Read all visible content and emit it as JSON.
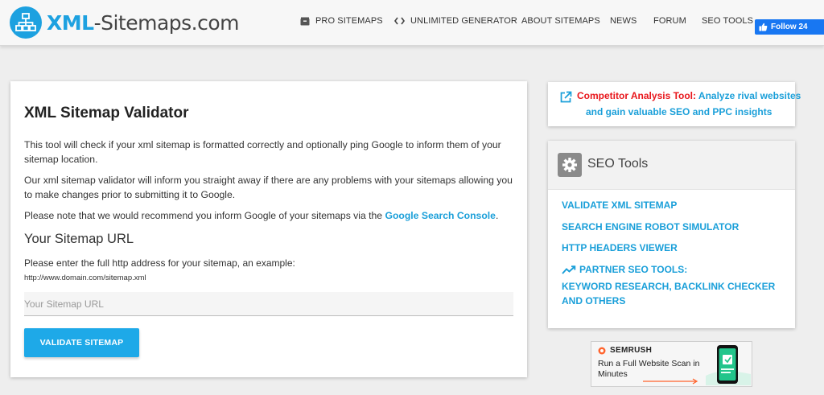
{
  "header": {
    "logo_xml": "XML",
    "logo_rest": "-Sitemaps.com",
    "nav": [
      {
        "label": "PRO SITEMAPS",
        "icon": "box-icon"
      },
      {
        "label": "UNLIMITED GENERATOR",
        "icon": "code-icon"
      },
      {
        "label": "ABOUT SITEMAPS"
      },
      {
        "label": "NEWS"
      },
      {
        "label": "FORUM"
      },
      {
        "label": "SEO TOOLS"
      }
    ],
    "follow_label": "Follow 24"
  },
  "main": {
    "title": "XML Sitemap Validator",
    "para1": "This tool will check if your xml sitemap is formatted correctly and optionally ping Google to inform them of your sitemap location.",
    "para2": "Our xml sitemap validator will inform you straight away if there are any problems with your sitemaps allowing you to make changes prior to submitting it to Google.",
    "para3_prefix": "Please note that we would recommend you inform Google of your sitemaps via the ",
    "para3_link": "Google Search Console",
    "para3_suffix": ".",
    "subheading": "Your Sitemap URL",
    "instructions": "Please enter the full http address for your sitemap, an example:",
    "example": "http://www.domain.com/sitemap.xml",
    "input_placeholder": "Your Sitemap URL",
    "input_value": "",
    "button_label": "VALIDATE SITEMAP"
  },
  "promo": {
    "label_red": "Competitor Analysis Tool:",
    "label_blue_1": " Analyze rival websites",
    "label_blue_2": "and gain valuable SEO and PPC insights"
  },
  "seo_tools": {
    "title": "SEO Tools",
    "links": [
      "VALIDATE XML SITEMAP",
      "SEARCH ENGINE ROBOT SIMULATOR",
      "HTTP HEADERS VIEWER"
    ],
    "partner_label": "PARTNER SEO TOOLS:",
    "partner_line1": "KEYWORD RESEARCH, BACKLINK CHECKER",
    "partner_line2": "AND OTHERS"
  },
  "ad": {
    "brand": "SEMRUSH",
    "text": "Run a Full Website Scan in Minutes"
  },
  "colors": {
    "accent": "#1da1e0",
    "link": "#1a9fd9",
    "promo_red": "#e8161b",
    "button": "#1ea9e8",
    "facebook": "#1877f2"
  }
}
